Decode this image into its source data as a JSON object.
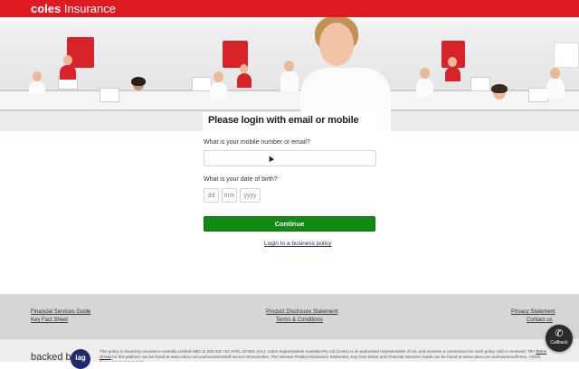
{
  "header": {
    "brand_bold": "coles",
    "brand_rest": "Insurance",
    "brand_color": "#e01a22"
  },
  "hero": {
    "image": "customer-service-team-photo"
  },
  "login": {
    "title": "Please login with email or mobile",
    "contact_label": "What is your mobile number or email?",
    "contact_value": "",
    "dob_label": "What is your date of birth?",
    "dob_dd_placeholder": "dd",
    "dob_mm_placeholder": "mm",
    "dob_yyyy_placeholder": "yyyy",
    "continue_label": "Continue",
    "continue_color": "#138a13",
    "business_link": "Login to a business policy"
  },
  "footer": {
    "left_links": [
      "Financial Services Guide",
      "Key Fact Sheet"
    ],
    "center_links": [
      "Product Disclosure Statement",
      "Terms & Conditions"
    ],
    "right_links": [
      "Privacy Statement",
      "Contact us"
    ]
  },
  "bottom": {
    "backed_by": "backed by",
    "iag_logo": "iag",
    "disclaimer_start": "This policy is issued by Insurance Australia Limited ABN 11 000 016 722 AFSL 227681 (IAL). Coles Supermarkets Australia Pty Ltd (Coles) is an authorised representative of IAL and receives a commission for each policy sold or renewed. The ",
    "disclaimer_link": "Terms of Use",
    "disclaimer_end": " for this platform can be found at www.coles.com.au/insurance/self-service-terms/online. The relevant Product Disclosure Statement, Key Fact Sheet and Financial Services Guide can be found at www.coles.com.au/insurance/forms. Check these documents to help"
  },
  "callback": {
    "icon": "phone-icon",
    "label": "Callback"
  }
}
